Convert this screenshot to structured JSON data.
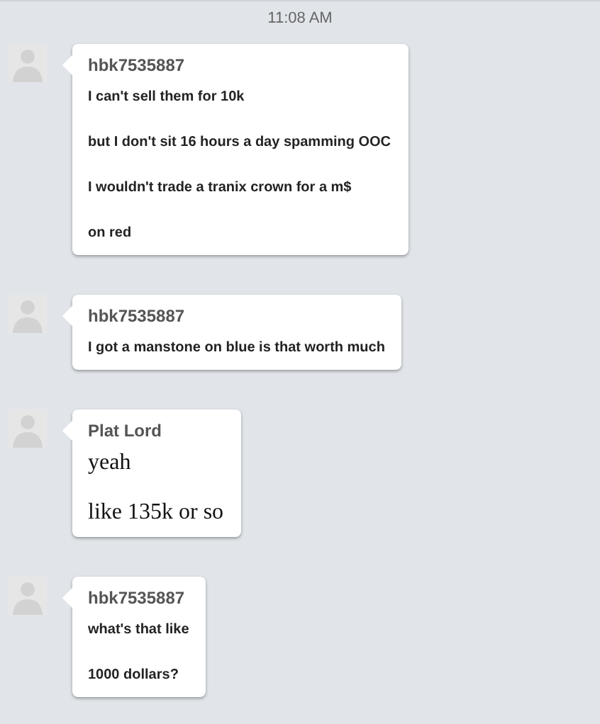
{
  "timestamp": "11:08 AM",
  "messages": [
    {
      "sender": "hbk7535887",
      "lines": [
        {
          "kind": "sans",
          "text": "I can't sell them for 10k"
        },
        {
          "kind": "sans",
          "text": "but I don't sit 16 hours a day spamming OOC"
        },
        {
          "kind": "sans",
          "text": "I wouldn't trade a tranix crown for a m$"
        },
        {
          "kind": "sans",
          "text": "on red"
        }
      ]
    },
    {
      "sender": "hbk7535887",
      "lines": [
        {
          "kind": "sans",
          "text": "I got a manstone on blue is that worth much"
        }
      ]
    },
    {
      "sender": "Plat Lord",
      "lines": [
        {
          "kind": "serif",
          "text": "yeah"
        },
        {
          "kind": "serif",
          "text": "like 135k or so"
        }
      ]
    },
    {
      "sender": "hbk7535887",
      "lines": [
        {
          "kind": "sans",
          "text": "what's that like"
        },
        {
          "kind": "sans",
          "text": "1000 dollars?"
        }
      ]
    }
  ]
}
